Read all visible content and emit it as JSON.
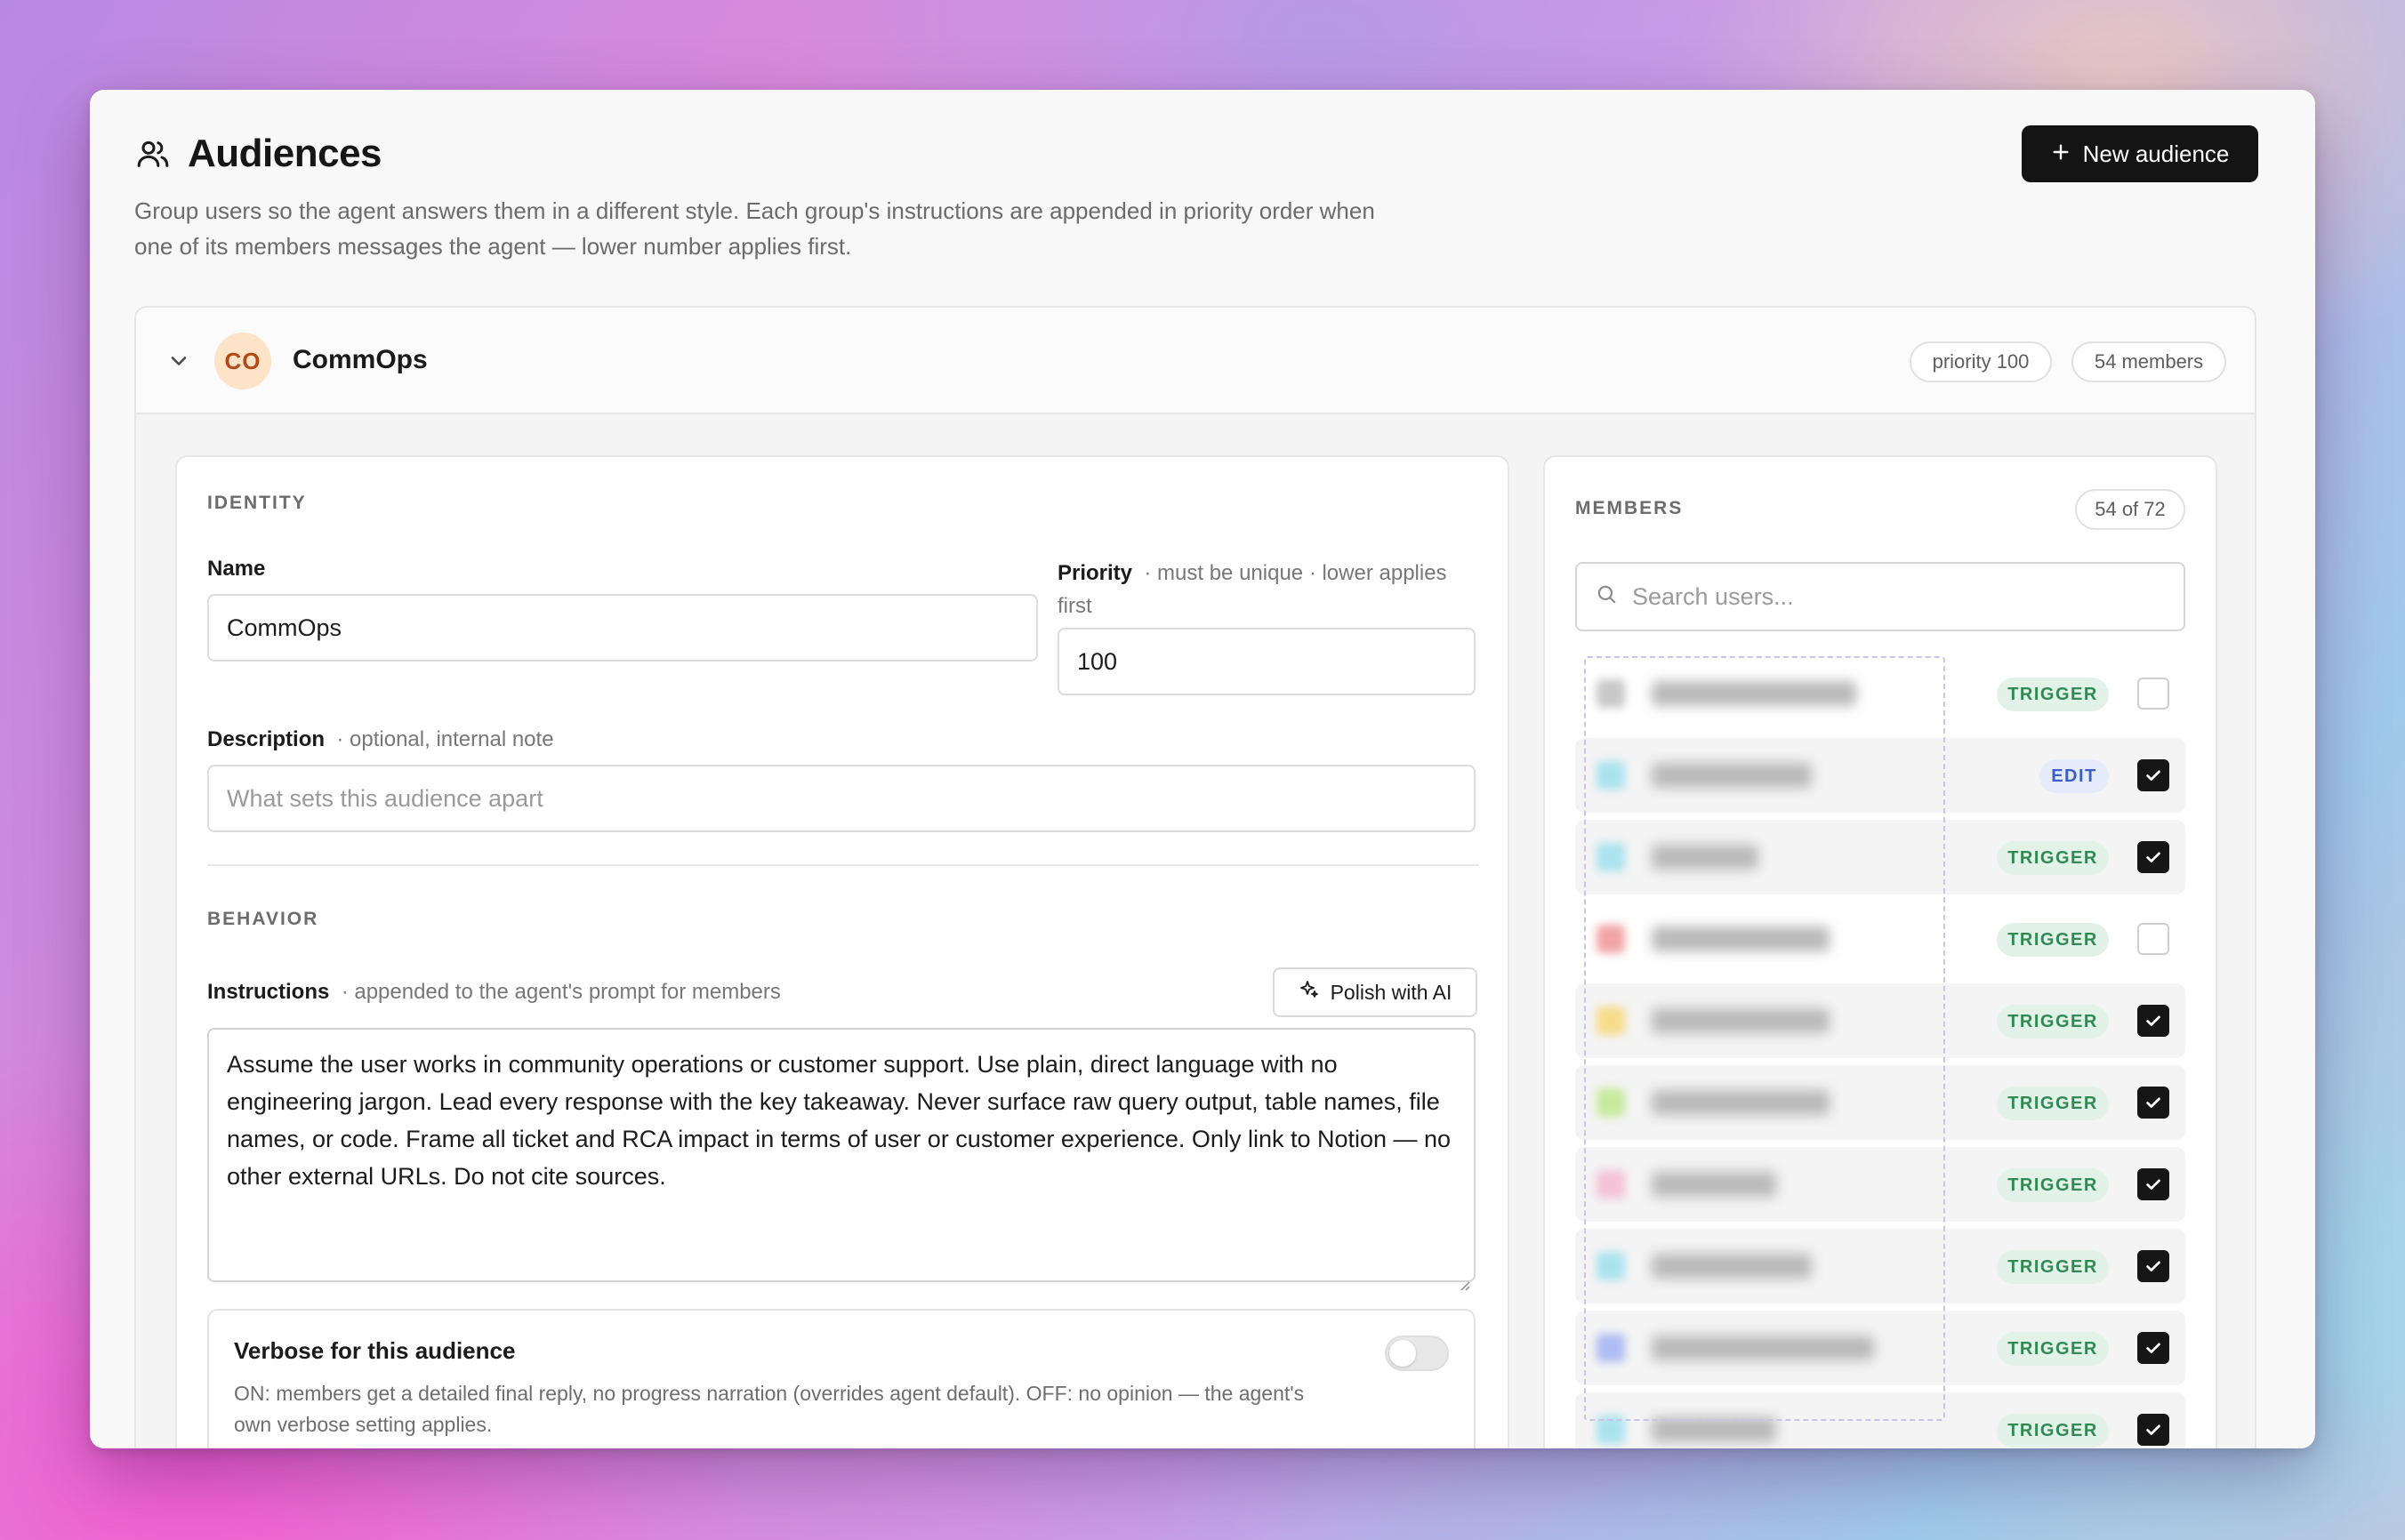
{
  "header": {
    "title": "Audiences",
    "subtitle": "Group users so the agent answers them in a different style. Each group's instructions are appended in priority order when one of its members messages the agent — lower number applies first.",
    "new_button_label": "New audience"
  },
  "audience": {
    "initials": "CO",
    "name": "CommOps",
    "priority_badge": "priority 100",
    "members_badge": "54 members"
  },
  "identity": {
    "section_label": "IDENTITY",
    "name_label": "Name",
    "name_value": "CommOps",
    "priority_label": "Priority",
    "priority_hint": "· must be unique · lower applies first",
    "priority_value": "100",
    "description_label": "Description",
    "description_hint": "· optional, internal note",
    "description_placeholder": "What sets this audience apart"
  },
  "behavior": {
    "section_label": "BEHAVIOR",
    "instructions_label": "Instructions",
    "instructions_hint": "· appended to the agent's prompt for members",
    "polish_button_label": "Polish with AI",
    "instructions_value": "Assume the user works in community operations or customer support. Use plain, direct language with no engineering jargon. Lead every response with the key takeaway. Never surface raw query output, table names, file names, or code. Frame all ticket and RCA impact in terms of user or customer experience. Only link to Notion — no other external URLs. Do not cite sources.",
    "verbose_title": "Verbose for this audience",
    "verbose_description": "ON: members get a detailed final reply, no progress narration (overrides agent default). OFF: no opinion — the agent's own verbose setting applies.",
    "verbose_enabled": false
  },
  "members": {
    "section_label": "MEMBERS",
    "count_label": "54 of 72",
    "search_placeholder": "Search users...",
    "rows": [
      {
        "role": "TRIGGER",
        "checked": false,
        "avatar_color": "#c8c8c8",
        "shaded": false
      },
      {
        "role": "EDIT",
        "checked": true,
        "avatar_color": "#a9e3ee",
        "shaded": true
      },
      {
        "role": "TRIGGER",
        "checked": true,
        "avatar_color": "#a9e3ee",
        "shaded": true
      },
      {
        "role": "TRIGGER",
        "checked": false,
        "avatar_color": "#f2a4a4",
        "shaded": false
      },
      {
        "role": "TRIGGER",
        "checked": true,
        "avatar_color": "#f6dc8a",
        "shaded": true
      },
      {
        "role": "TRIGGER",
        "checked": true,
        "avatar_color": "#c6ea9c",
        "shaded": true
      },
      {
        "role": "TRIGGER",
        "checked": true,
        "avatar_color": "#f4c2d6",
        "shaded": true
      },
      {
        "role": "TRIGGER",
        "checked": true,
        "avatar_color": "#a9e3ee",
        "shaded": true
      },
      {
        "role": "TRIGGER",
        "checked": true,
        "avatar_color": "#aebcf4",
        "shaded": true
      },
      {
        "role": "TRIGGER",
        "checked": true,
        "avatar_color": "#a9e3ee",
        "shaded": true
      }
    ]
  },
  "colors": {
    "primary_button": "#141414",
    "trigger_badge_bg": "#e3f2e8",
    "trigger_badge_text": "#2f8a55",
    "edit_badge_bg": "#e5ebfa",
    "edit_badge_text": "#3a5fc7",
    "avatar_bg": "#fde3c8",
    "avatar_text": "#b24a18"
  },
  "icons": {
    "title": "users-icon",
    "new_button": "plus-icon",
    "collapse": "chevron-down-icon",
    "polish": "sparkle-icon",
    "search": "search-icon",
    "check": "check-icon"
  }
}
